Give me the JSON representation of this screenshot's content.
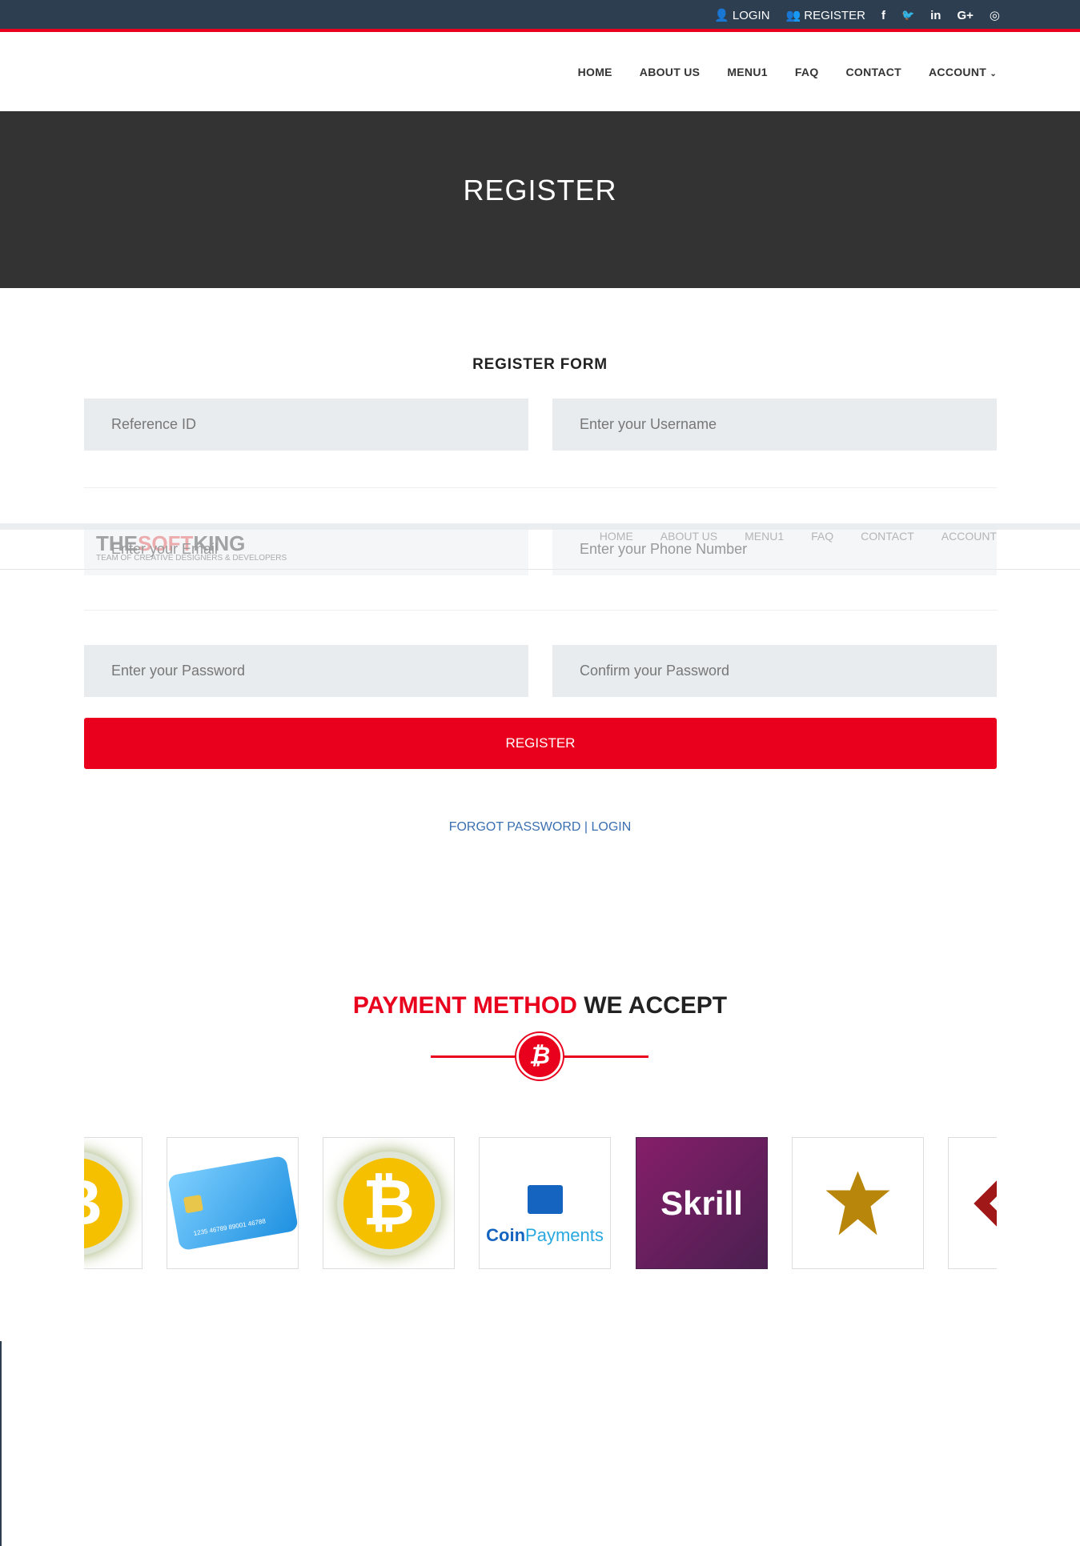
{
  "topbar": {
    "login": "LOGIN",
    "register": "REGISTER",
    "social": [
      "facebook-icon",
      "twitter-icon",
      "linkedin-icon",
      "google-plus-icon",
      "instagram-icon"
    ],
    "social_glyphs": [
      "f",
      "🐦",
      "in",
      "G+",
      "◎"
    ]
  },
  "nav": {
    "items": [
      "HOME",
      "ABOUT US",
      "MENU1",
      "FAQ",
      "CONTACT",
      "ACCOUNT"
    ]
  },
  "banner": {
    "title": "REGISTER"
  },
  "form": {
    "title": "REGISTER FORM",
    "reference_placeholder": "Reference ID",
    "username_placeholder": "Enter your Username",
    "email_placeholder": "Enter your Email",
    "phone_placeholder": "Enter your Phone Number",
    "password_placeholder": "Enter your Password",
    "confirm_placeholder": "Confirm your Password",
    "submit": "REGISTER",
    "forgot": "FORGOT PASSWORD",
    "sep": " | ",
    "login": "LOGIN"
  },
  "sticky_header": {
    "logo": {
      "the": "THE",
      "soft": "SOFT",
      "king": "KING"
    },
    "tagline": "TEAM OF CREATIVE DESIGNERS & DEVELOPERS"
  },
  "payment": {
    "title_red": "PAYMENT METHOD",
    "title_dark": " WE ACCEPT",
    "icon": "bitcoin-icon",
    "methods": [
      "Bitcoin",
      "Credit Card",
      "Bitcoin",
      "CoinPayments",
      "Skrill",
      "Gold emblem",
      "Red emblem"
    ],
    "coinpayments": {
      "coin": "Coin",
      "payments": "Payments"
    },
    "skrill": "Skrill",
    "card_number": "1235 46789 89001 46788"
  },
  "colors": {
    "accent": "#e8001c",
    "topbar": "#2d3e50",
    "banner": "#333333",
    "skrill": "#7a1f63"
  }
}
